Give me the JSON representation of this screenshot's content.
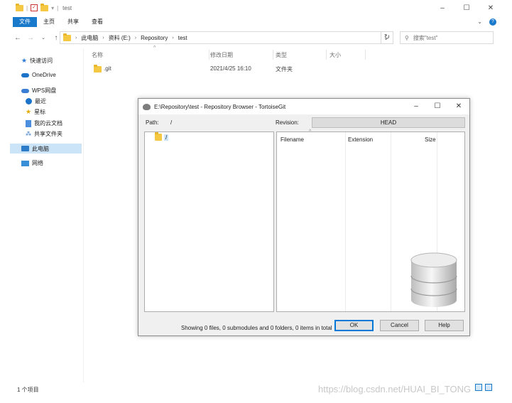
{
  "explorer": {
    "title": "test",
    "ribbon_tabs": [
      "文件",
      "主页",
      "共享",
      "查看"
    ],
    "breadcrumb": [
      "此电脑",
      "资料 (E:)",
      "Repository",
      "test"
    ],
    "search_placeholder": "搜索\"test\"",
    "nav_items": {
      "quick_access": "快速访问",
      "onedrive": "OneDrive",
      "wps": "WPS网盘",
      "recent": "最近",
      "starred": "星标",
      "my_cloud_docs": "我的云文档",
      "shared_folder": "共享文件夹",
      "this_pc": "此电脑",
      "network": "网络"
    },
    "columns": {
      "name": "名称",
      "modified": "修改日期",
      "type": "类型",
      "size": "大小"
    },
    "files": [
      {
        "name": ".git",
        "modified": "2021/4/25 16:10",
        "type": "文件夹",
        "size": ""
      }
    ],
    "status": "1 个项目"
  },
  "dialog": {
    "title": "E:\\Repository\\test - Repository Browser - TortoiseGit",
    "path_label": "Path:",
    "path_value": "/",
    "revision_label": "Revision:",
    "revision_value": "HEAD",
    "tree_root": "/",
    "list_columns": {
      "filename": "Filename",
      "extension": "Extension",
      "size": "Size"
    },
    "status": "Showing 0 files, 0 submodules and 0 folders, 0 items in total",
    "ok_label": "OK",
    "cancel_label": "Cancel",
    "help_label": "Help"
  },
  "watermark": "https://blog.csdn.net/HUAI_BI_TONG"
}
